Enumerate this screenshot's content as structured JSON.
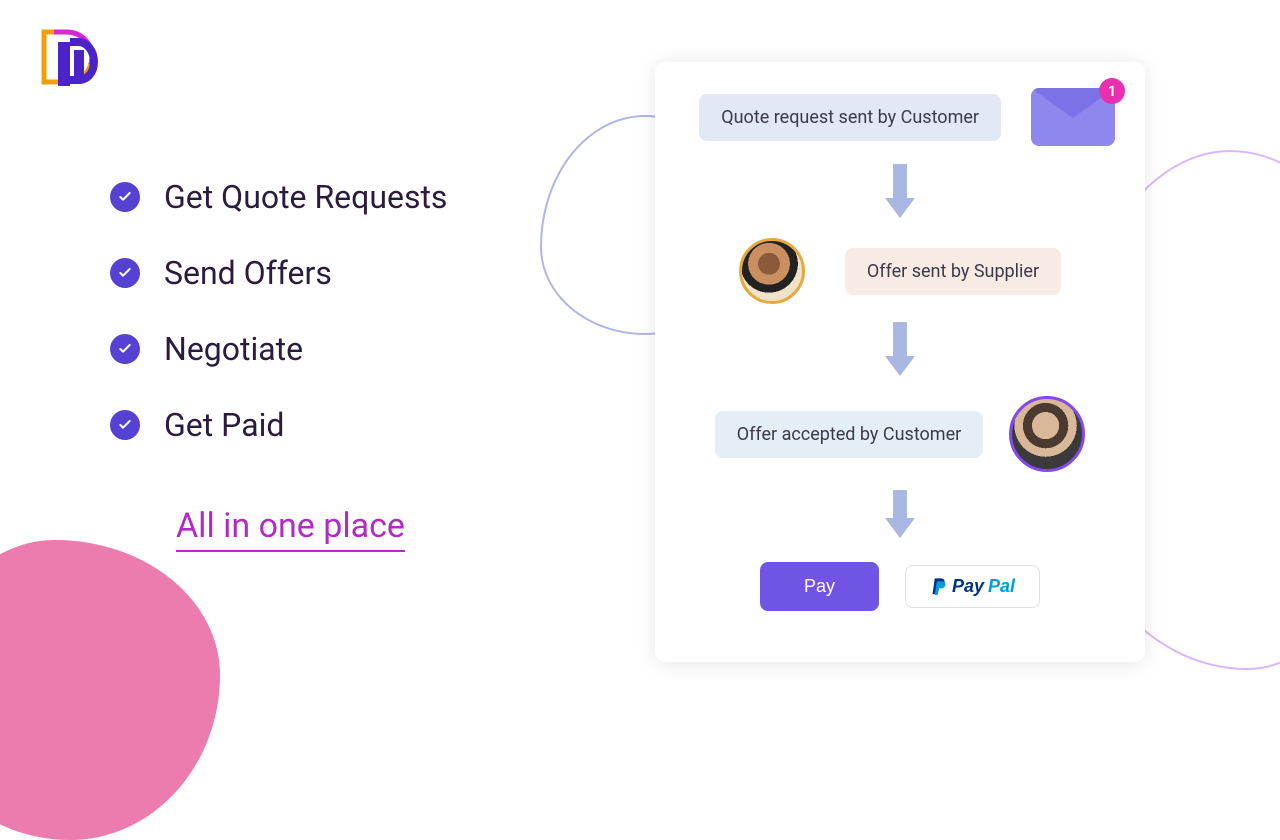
{
  "features": {
    "item1": "Get Quote Requests",
    "item2": "Send Offers",
    "item3": "Negotiate",
    "item4": "Get Paid"
  },
  "tagline": "All in one place",
  "flow": {
    "step1": "Quote request sent by Customer",
    "step2": "Offer sent by Supplier",
    "step3": "Offer accepted by Customer",
    "notification_count": "1"
  },
  "buttons": {
    "pay": "Pay",
    "paypal_pay": "Pay",
    "paypal_pal": "Pal"
  }
}
